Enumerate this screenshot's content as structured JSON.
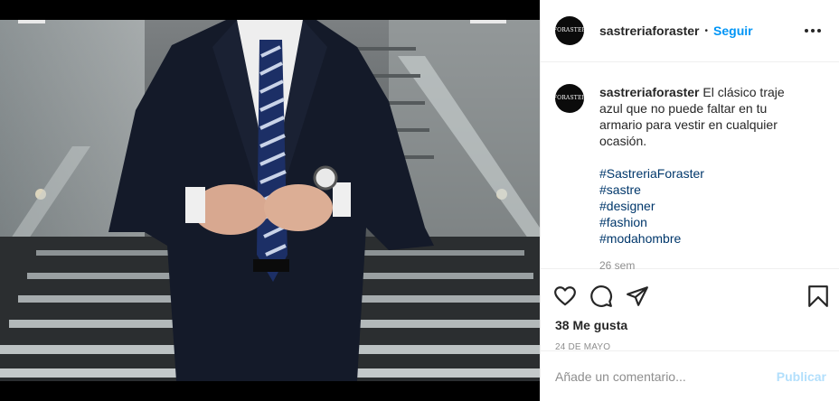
{
  "post": {
    "username": "sastreriaforaster",
    "follow_label": "Seguir",
    "separator": "•",
    "avatar_logo": "FORASTER",
    "caption": {
      "username": "sastreriaforaster",
      "text": "El clásico traje azul que no puede faltar en tu armario para vestir en cualquier ocasión.",
      "hashtags": [
        "#SastreriaForaster",
        "#sastre",
        "#designer",
        "#fashion",
        "#modahombre"
      ],
      "time": "26 sem"
    },
    "likes_text": "38 Me gusta",
    "date": "24 DE MAYO",
    "comment_placeholder": "Añade un comentario...",
    "publish_label": "Publicar"
  },
  "icons": {
    "more": "more-options-icon",
    "like": "heart-icon",
    "comment": "comment-icon",
    "share": "share-icon",
    "save": "bookmark-icon"
  },
  "colors": {
    "accent": "#0095f6",
    "hashtag": "#00376b",
    "muted": "#8e8e8e",
    "publish_disabled": "#b2dffc"
  }
}
